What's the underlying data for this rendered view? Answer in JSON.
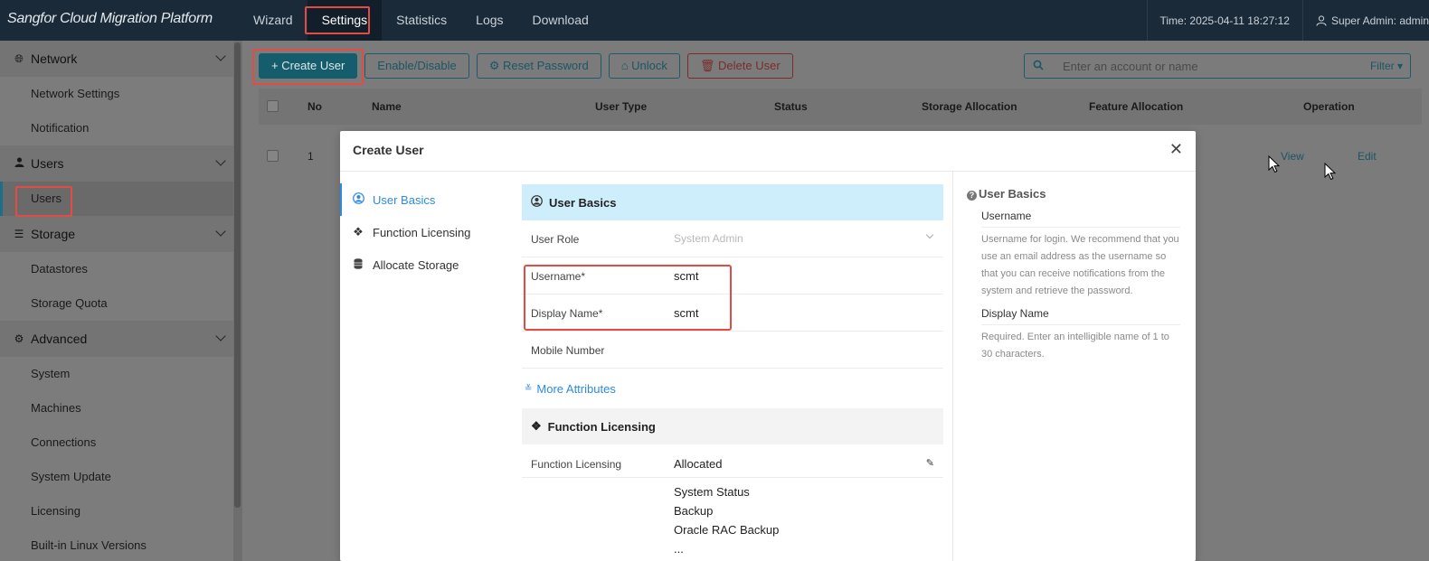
{
  "app": {
    "title": "Sangfor Cloud Migration Platform"
  },
  "topnav": [
    "Wizard",
    "Settings",
    "Statistics",
    "Logs",
    "Download"
  ],
  "header": {
    "time": "Time: 2025-04-11 18:27:12",
    "user": "Super Admin: admin"
  },
  "sidebar": {
    "groups": [
      {
        "label": "Network",
        "icon": "globe-icon",
        "items": [
          "Network Settings",
          "Notification"
        ]
      },
      {
        "label": "Users",
        "icon": "user-icon",
        "items": [
          "Users"
        ]
      },
      {
        "label": "Storage",
        "icon": "list-icon",
        "items": [
          "Datastores",
          "Storage Quota"
        ]
      },
      {
        "label": "Advanced",
        "icon": "gear-icon",
        "items": [
          "System",
          "Machines",
          "Connections",
          "System Update",
          "Licensing",
          "Built-in Linux Versions"
        ]
      }
    ]
  },
  "toolbar": {
    "create": "+ Create User",
    "enable": "Enable/Disable",
    "reset": "Reset Password",
    "unlock": "Unlock",
    "delete": "Delete User"
  },
  "search": {
    "placeholder": "Enter an account or name",
    "filter": "Filter"
  },
  "table": {
    "columns": [
      "No",
      "Name",
      "User Type",
      "Status",
      "Storage Allocation",
      "Feature Allocation",
      "Operation"
    ],
    "rows": [
      {
        "no": "1",
        "view": "View",
        "edit": "Edit"
      }
    ]
  },
  "modal": {
    "title": "Create User",
    "nav": [
      "User Basics",
      "Function Licensing",
      "Allocate Storage"
    ],
    "basics": {
      "heading": "User Basics",
      "role_label": "User Role",
      "role_placeholder": "System Admin",
      "username_label": "Username*",
      "username_value": "scmt",
      "display_label": "Display Name*",
      "display_value": "scmt",
      "mobile_label": "Mobile Number",
      "more": "More Attributes"
    },
    "licensing": {
      "heading": "Function Licensing",
      "label": "Function Licensing",
      "value": "Allocated",
      "items": [
        "System Status",
        "Backup",
        "Oracle RAC Backup",
        "..."
      ]
    },
    "help": {
      "title": "User Basics",
      "username_title": "Username",
      "username_text": "Username for login. We recommend that you use an email address as the username so that you can receive notifications from the system and retrieve the password.",
      "display_title": "Display Name",
      "display_text": "Required. Enter an intelligible name of 1 to 30 characters."
    }
  },
  "colors": {
    "accent": "#2b8be0",
    "highlight": "#e44b45",
    "topbar": "#1b2a38",
    "teal": "#155c6c"
  }
}
